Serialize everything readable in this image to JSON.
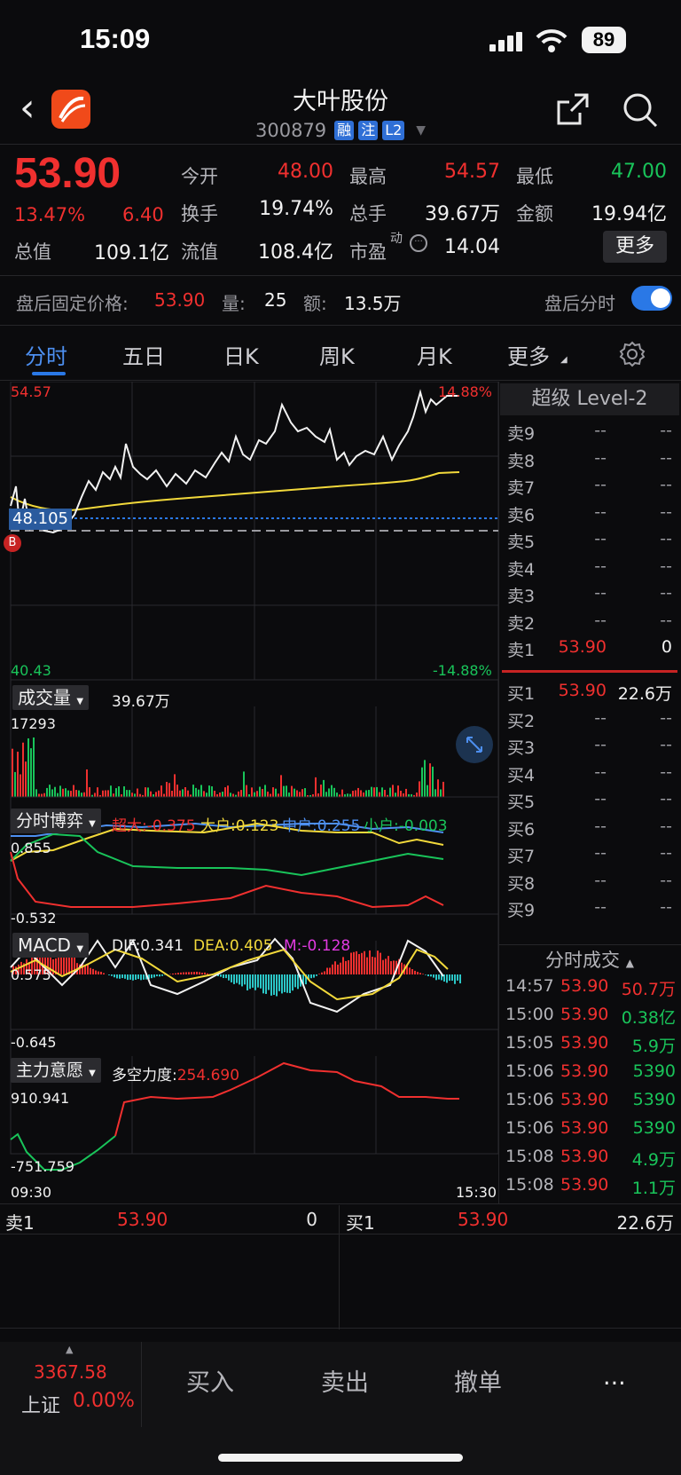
{
  "status_bar": {
    "time": "15:09",
    "battery": "89"
  },
  "header": {
    "stock_name": "大叶股份",
    "stock_code": "300879",
    "tags": [
      "融",
      "注",
      "L2"
    ]
  },
  "quote": {
    "price": "53.90",
    "change_pct": "13.47%",
    "change_val": "6.40",
    "market_cap_label": "总值",
    "market_cap": "109.1亿",
    "open_label": "今开",
    "open": "48.00",
    "high_label": "最高",
    "high": "54.57",
    "low_label": "最低",
    "low": "47.00",
    "turnover_label": "换手",
    "turnover": "19.74%",
    "total_vol_label": "总手",
    "total_vol": "39.67万",
    "amount_label": "金额",
    "amount": "19.94亿",
    "float_cap_label": "流值",
    "float_cap": "108.4亿",
    "pe_label": "市盈",
    "pe_sup": "动",
    "pe": "14.04",
    "more_label": "更多"
  },
  "after_hours": {
    "label": "盘后固定价格:",
    "price": "53.90",
    "vol_label": "量:",
    "vol": "25",
    "amt_label": "额:",
    "amt": "13.5万",
    "toggle_label": "盘后分时",
    "toggle_on": true
  },
  "tabs": [
    "分时",
    "五日",
    "日K",
    "周K",
    "月K",
    "更多"
  ],
  "active_tab": "分时",
  "intraday": {
    "high_label": "54.57",
    "low_label": "40.43",
    "high_pct": "14.88%",
    "low_pct": "-14.88%",
    "avg_price_tag": "48.105",
    "time_start": "09:30",
    "time_end": "15:30",
    "buy_marker": "B"
  },
  "volume_panel": {
    "title": "成交量",
    "total": "39.67万",
    "max": "17293"
  },
  "game_panel": {
    "title": "分时博弈",
    "super_large": "超大:-0.375",
    "large": "大户:0.123",
    "medium": "中户:0.255",
    "small": "小户:-0.003",
    "top_label": "0.855",
    "bottom_label": "-0.532"
  },
  "macd_panel": {
    "title": "MACD",
    "dif": "DIF:0.341",
    "dea": "DEA:0.405",
    "m": "M:-0.128",
    "top_label": "0.575",
    "bottom_label": "-0.645"
  },
  "intent_panel": {
    "title": "主力意愿",
    "force": "多空力度:",
    "force_val": "254.690",
    "top_label": "910.941",
    "bottom_label": "-751.759"
  },
  "order_book": {
    "header": "超级 Level-2",
    "asks": [
      {
        "label": "卖9",
        "price": "--",
        "vol": "--"
      },
      {
        "label": "卖8",
        "price": "--",
        "vol": "--"
      },
      {
        "label": "卖7",
        "price": "--",
        "vol": "--"
      },
      {
        "label": "卖6",
        "price": "--",
        "vol": "--"
      },
      {
        "label": "卖5",
        "price": "--",
        "vol": "--"
      },
      {
        "label": "卖4",
        "price": "--",
        "vol": "--"
      },
      {
        "label": "卖3",
        "price": "--",
        "vol": "--"
      },
      {
        "label": "卖2",
        "price": "--",
        "vol": "--"
      },
      {
        "label": "卖1",
        "price": "53.90",
        "vol": "0"
      }
    ],
    "bids": [
      {
        "label": "买1",
        "price": "53.90",
        "vol": "22.6万"
      },
      {
        "label": "买2",
        "price": "--",
        "vol": "--"
      },
      {
        "label": "买3",
        "price": "--",
        "vol": "--"
      },
      {
        "label": "买4",
        "price": "--",
        "vol": "--"
      },
      {
        "label": "买5",
        "price": "--",
        "vol": "--"
      },
      {
        "label": "买6",
        "price": "--",
        "vol": "--"
      },
      {
        "label": "买7",
        "price": "--",
        "vol": "--"
      },
      {
        "label": "买8",
        "price": "--",
        "vol": "--"
      },
      {
        "label": "买9",
        "price": "--",
        "vol": "--"
      }
    ]
  },
  "ticks": {
    "header": "分时成交",
    "rows": [
      {
        "time": "14:57",
        "price": "53.90",
        "vol": "50.7万",
        "dir": "red"
      },
      {
        "time": "15:00",
        "price": "53.90",
        "vol": "0.38亿",
        "dir": "green"
      },
      {
        "time": "15:05",
        "price": "53.90",
        "vol": "5.9万",
        "dir": "green"
      },
      {
        "time": "15:06",
        "price": "53.90",
        "vol": "5390",
        "dir": "green"
      },
      {
        "time": "15:06",
        "price": "53.90",
        "vol": "5390",
        "dir": "green"
      },
      {
        "time": "15:06",
        "price": "53.90",
        "vol": "5390",
        "dir": "green"
      },
      {
        "time": "15:08",
        "price": "53.90",
        "vol": "4.9万",
        "dir": "green"
      },
      {
        "time": "15:08",
        "price": "53.90",
        "vol": "1.1万",
        "dir": "green"
      }
    ]
  },
  "bbo": {
    "ask_label": "卖1",
    "ask_price": "53.90",
    "ask_vol": "0",
    "bid_label": "买1",
    "bid_price": "53.90",
    "bid_vol": "22.6万"
  },
  "bottom_nav": {
    "index_value": "3367.58",
    "index_name": "上证",
    "index_change": "0.00%",
    "buy": "买入",
    "sell": "卖出",
    "cancel": "撤单",
    "more": "..."
  },
  "colors": {
    "up": "#f0302f",
    "down": "#19c45a",
    "accent": "#2a78e6",
    "avg_line": "#f2d93b"
  }
}
